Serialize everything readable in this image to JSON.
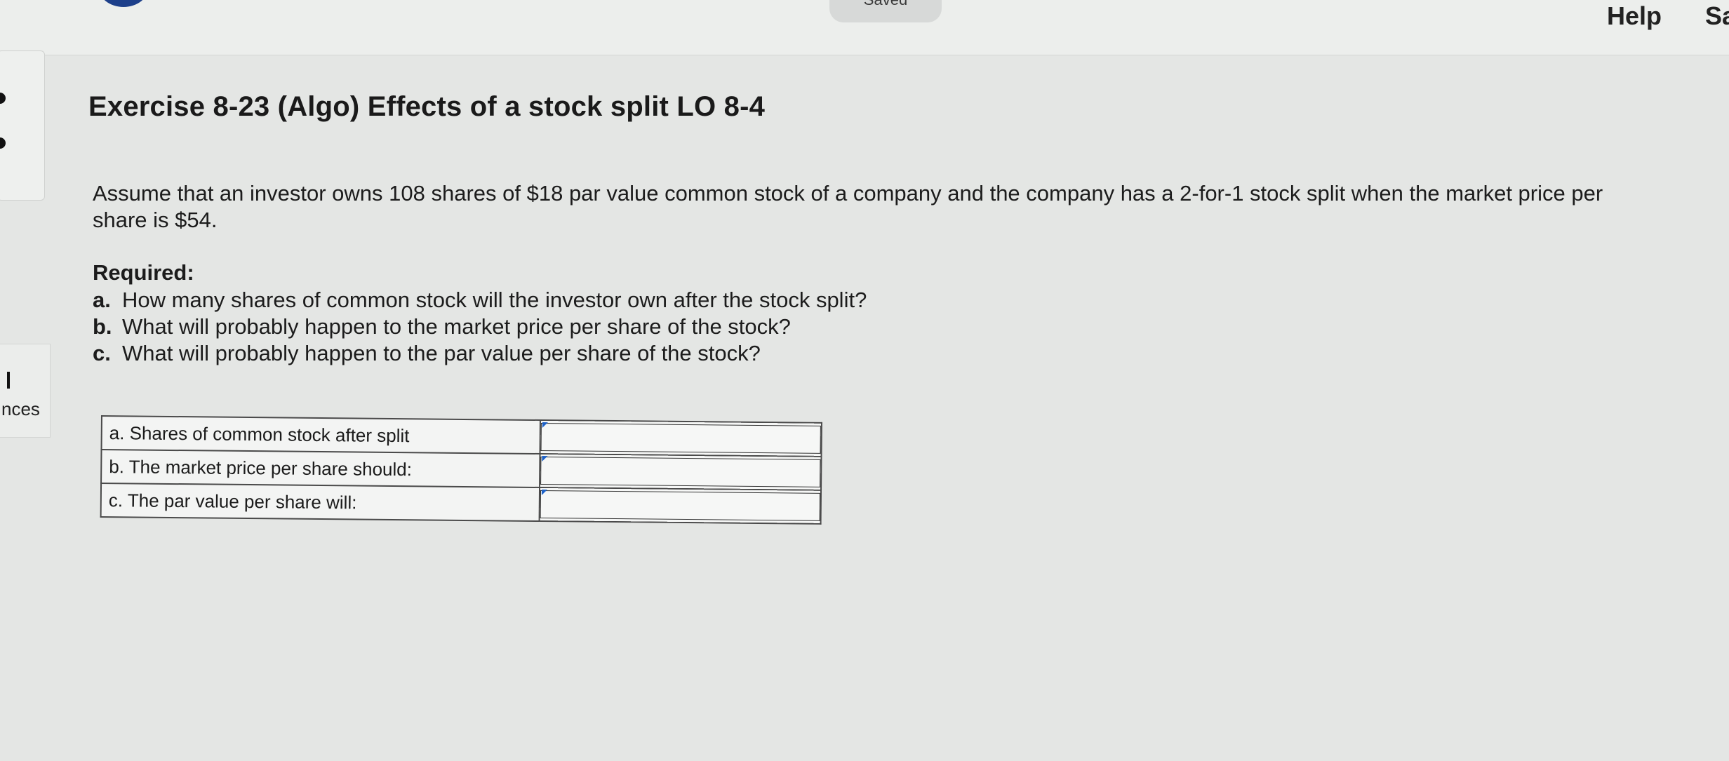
{
  "topbar": {
    "saved_label": "Saved",
    "help_label": "Help",
    "save_exit_label": "Sa"
  },
  "side": {
    "references_label": "nces"
  },
  "exercise": {
    "title": "Exercise 8-23 (Algo) Effects of a stock split LO 8-4",
    "prompt": "Assume that an investor owns 108 shares of $18 par value common stock of a company and the company has a 2-for-1 stock split when the market price per share is $54.",
    "required_label": "Required:",
    "requirements": [
      {
        "letter": "a.",
        "text": "How many shares of common stock will the investor own after the stock split?"
      },
      {
        "letter": "b.",
        "text": "What will probably happen to the market price per share of the stock?"
      },
      {
        "letter": "c.",
        "text": "What will probably happen to the par value per share of the stock?"
      }
    ]
  },
  "answer_table": {
    "rows": [
      {
        "label": "a. Shares of common stock after split",
        "value": ""
      },
      {
        "label": "b. The market price per share should:",
        "value": ""
      },
      {
        "label": "c. The par value per share will:",
        "value": ""
      }
    ]
  },
  "colors": {
    "background": "#e4e6e4",
    "brand_blue": "#1d3f8a",
    "input_marker": "#1e62c8",
    "text": "#1c1c1c"
  }
}
